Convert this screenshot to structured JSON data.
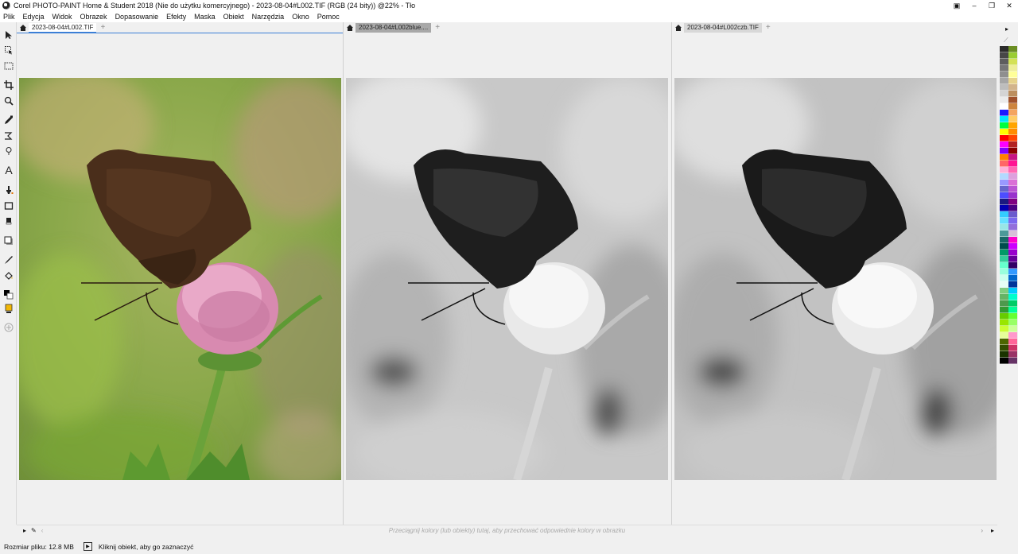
{
  "window": {
    "title": "Corel PHOTO-PAINT Home & Student 2018 (Nie do użytku komercyjnego) - 2023-08-04#L002.TIF (RGB (24 bity)) @22% - Tło",
    "controls": [
      "▣",
      "–",
      "❐",
      "✕"
    ]
  },
  "menu": [
    "Plik",
    "Edycja",
    "Widok",
    "Obrazek",
    "Dopasowanie",
    "Efekty",
    "Maska",
    "Obiekt",
    "Narzędzia",
    "Okno",
    "Pomoc"
  ],
  "documents": [
    {
      "tab": "2023-08-04#L002.TIF",
      "active": true,
      "mode": "color"
    },
    {
      "tab": "2023-08-04#L002blue....",
      "active": false,
      "mode": "grayscale"
    },
    {
      "tab": "2023-08-04#L002czb.TIF",
      "active": false,
      "mode": "grayscale"
    }
  ],
  "tools": [
    "pick-icon",
    "freehand-pick-icon",
    "rectangle-mask-icon",
    "crop-icon",
    "zoom-icon",
    "eyedropper-icon",
    "transform-icon",
    "lasso-icon",
    "text-icon",
    "paint-icon",
    "rectangle-icon",
    "eraser-icon",
    "shadow-icon",
    "brush-icon",
    "fill-icon",
    "color-swatch-icon",
    "add-icon"
  ],
  "colorbar": {
    "hint": "Przeciągnij kolory (lub obiekty) tutaj, aby przechować odpowiednie kolory w obrazku"
  },
  "status": {
    "file_size": "Rozmiar pliku: 12.8 MB",
    "hint": "Kliknij obiekt, aby go zaznaczyć"
  },
  "palette": {
    "col1": [
      "#2b2b2b",
      "#474747",
      "#5e5e5e",
      "#777777",
      "#8f8f8f",
      "#a6a6a6",
      "#bdbdbd",
      "#d4d4d4",
      "#ebebeb",
      "#ffffff",
      "#1a1aff",
      "#00e5ff",
      "#00ff40",
      "#ffff00",
      "#ff0000",
      "#ff00ff",
      "#8000ff",
      "#ff8000",
      "#ff6666",
      "#ffb3d9",
      "#b3d9ff",
      "#9999ff",
      "#6666cc",
      "#4d4dff",
      "#1a1a80",
      "#0000b3",
      "#33ccff",
      "#66e0ff",
      "#99e6e6",
      "#4d9999",
      "#1a6666",
      "#004d4d",
      "#009966",
      "#33cc99",
      "#66ffcc",
      "#99ffdd",
      "#ccffee",
      "#e6fff5",
      "#80cc80",
      "#66b366",
      "#4d994d",
      "#339933",
      "#66cc00",
      "#99e600",
      "#ccff33",
      "#e6ff99",
      "#4d6600",
      "#334d00",
      "#1a3300",
      "#000000"
    ],
    "col2": [
      "#6b8e23",
      "#9acd32",
      "#d4e157",
      "#eeee99",
      "#ffff99",
      "#e6d28c",
      "#d2b48c",
      "#bc8f5f",
      "#a0522d",
      "#cd853f",
      "#f4a460",
      "#ffcc66",
      "#ffa500",
      "#ff8c00",
      "#ff4500",
      "#b22222",
      "#8b0000",
      "#c71585",
      "#ff1493",
      "#ff69b4",
      "#dda0dd",
      "#da70d6",
      "#ba55d3",
      "#9932cc",
      "#800080",
      "#4b0082",
      "#6a5acd",
      "#7b68ee",
      "#9370db",
      "#d8bfd8",
      "#ff00cc",
      "#cc00ff",
      "#9900cc",
      "#660099",
      "#330066",
      "#3399ff",
      "#0066cc",
      "#003399",
      "#00ccff",
      "#00ffcc",
      "#00cc66",
      "#00ff99",
      "#66ff33",
      "#99ff66",
      "#ccff99",
      "#ff99cc",
      "#ff6699",
      "#cc3366",
      "#993366",
      "#663366"
    ]
  }
}
